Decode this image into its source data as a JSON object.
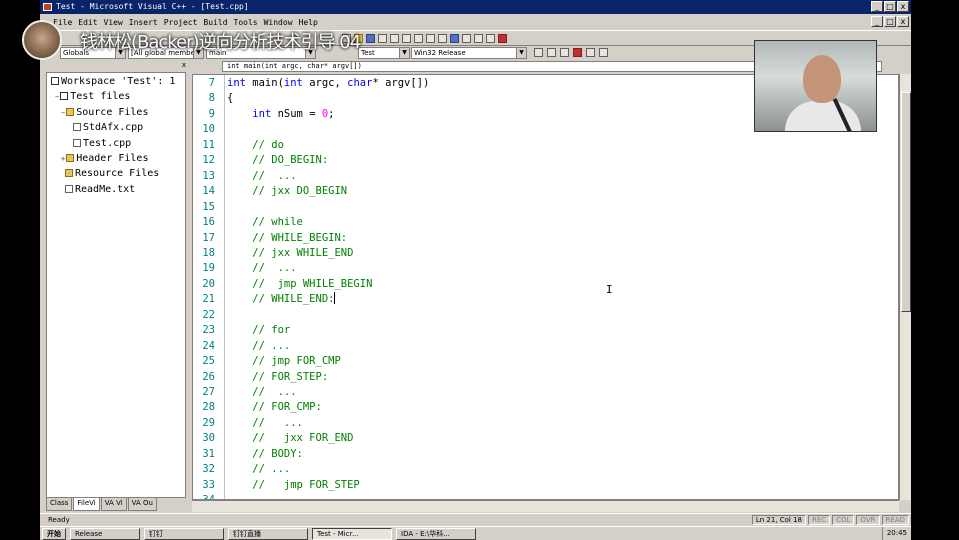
{
  "window": {
    "title": "Test - Microsoft Visual C++ - [Test.cpp]",
    "min_label": "_",
    "restore_label": "□",
    "close_label": "x"
  },
  "menu": [
    "File",
    "Edit",
    "View",
    "Insert",
    "Project",
    "Build",
    "Tools",
    "Window",
    "Help"
  ],
  "toolbar": {
    "scope_combo": "Globals",
    "members_combo": "[All global members",
    "function_combo": "main",
    "project_combo": "Test",
    "config_combo": "Win32 Release"
  },
  "workspace": {
    "close_label": "x",
    "tree": [
      {
        "label": "Workspace 'Test': 1",
        "icon": "workspace-icon",
        "kind": "ws",
        "expander": ""
      },
      {
        "label": "Test files",
        "icon": "project-icon",
        "kind": "ws",
        "expander": "−"
      },
      {
        "label": "Source Files",
        "icon": "folder-icon",
        "kind": "folder",
        "expander": "−"
      },
      {
        "label": "StdAfx.cpp",
        "icon": "file-icon",
        "kind": "file",
        "expander": ""
      },
      {
        "label": "Test.cpp",
        "icon": "file-icon",
        "kind": "file",
        "expander": ""
      },
      {
        "label": "Header Files",
        "icon": "folder-icon",
        "kind": "folder",
        "expander": "+"
      },
      {
        "label": "Resource Files",
        "icon": "folder-icon",
        "kind": "folder",
        "expander": ""
      },
      {
        "label": "ReadMe.txt",
        "icon": "file-icon",
        "kind": "file",
        "expander": ""
      }
    ],
    "tabs": [
      "Class",
      "FileVi",
      "VA Vi",
      "VA Ou"
    ]
  },
  "editor": {
    "function_bar": "int main(int argc, char* argv[])",
    "lines": [
      {
        "n": "7",
        "parts": [
          {
            "t": "int",
            "c": "kw"
          },
          {
            "t": " main(",
            "c": ""
          },
          {
            "t": "int",
            "c": "kw"
          },
          {
            "t": " argc, ",
            "c": ""
          },
          {
            "t": "char",
            "c": "kw"
          },
          {
            "t": "* argv[])",
            "c": ""
          }
        ]
      },
      {
        "n": "8",
        "parts": [
          {
            "t": "{",
            "c": ""
          }
        ]
      },
      {
        "n": "9",
        "parts": [
          {
            "t": "    ",
            "c": ""
          },
          {
            "t": "int",
            "c": "kw"
          },
          {
            "t": " nSum = ",
            "c": ""
          },
          {
            "t": "0",
            "c": "num"
          },
          {
            "t": ";",
            "c": ""
          }
        ]
      },
      {
        "n": "10",
        "parts": []
      },
      {
        "n": "11",
        "parts": [
          {
            "t": "    // do",
            "c": "cm"
          }
        ]
      },
      {
        "n": "12",
        "parts": [
          {
            "t": "    // DO_BEGIN:",
            "c": "cm"
          }
        ]
      },
      {
        "n": "13",
        "parts": [
          {
            "t": "    //  ...",
            "c": "cm"
          }
        ]
      },
      {
        "n": "14",
        "parts": [
          {
            "t": "    // jxx DO_BEGIN",
            "c": "cm"
          }
        ]
      },
      {
        "n": "15",
        "parts": []
      },
      {
        "n": "16",
        "parts": [
          {
            "t": "    // while",
            "c": "cm"
          }
        ]
      },
      {
        "n": "17",
        "parts": [
          {
            "t": "    // WHILE_BEGIN:",
            "c": "cm"
          }
        ]
      },
      {
        "n": "18",
        "parts": [
          {
            "t": "    // jxx WHILE_END",
            "c": "cm"
          }
        ]
      },
      {
        "n": "19",
        "parts": [
          {
            "t": "    //  ...",
            "c": "cm"
          }
        ]
      },
      {
        "n": "20",
        "parts": [
          {
            "t": "    //  jmp WHILE_BEGIN",
            "c": "cm"
          }
        ]
      },
      {
        "n": "21",
        "parts": [
          {
            "t": "    // WHILE_END:",
            "c": "cm"
          }
        ],
        "caret": true
      },
      {
        "n": "22",
        "parts": []
      },
      {
        "n": "23",
        "parts": [
          {
            "t": "    // for",
            "c": "cm"
          }
        ]
      },
      {
        "n": "24",
        "parts": [
          {
            "t": "    // ...",
            "c": "cm"
          }
        ]
      },
      {
        "n": "25",
        "parts": [
          {
            "t": "    // jmp FOR_CMP",
            "c": "cm"
          }
        ]
      },
      {
        "n": "26",
        "parts": [
          {
            "t": "    // FOR_STEP:",
            "c": "cm"
          }
        ]
      },
      {
        "n": "27",
        "parts": [
          {
            "t": "    //  ...",
            "c": "cm"
          }
        ]
      },
      {
        "n": "28",
        "parts": [
          {
            "t": "    // FOR_CMP:",
            "c": "cm"
          }
        ]
      },
      {
        "n": "29",
        "parts": [
          {
            "t": "    //   ...",
            "c": "cm"
          }
        ]
      },
      {
        "n": "30",
        "parts": [
          {
            "t": "    //   jxx FOR_END",
            "c": "cm"
          }
        ]
      },
      {
        "n": "31",
        "parts": [
          {
            "t": "    // BODY:",
            "c": "cm"
          }
        ]
      },
      {
        "n": "32",
        "parts": [
          {
            "t": "    // ...",
            "c": "cm"
          }
        ]
      },
      {
        "n": "33",
        "parts": [
          {
            "t": "    //   jmp FOR_STEP",
            "c": "cm"
          }
        ]
      },
      {
        "n": "34",
        "parts": []
      }
    ]
  },
  "status": {
    "text": "Ready",
    "position": "Ln 21, Col 18",
    "panels": [
      {
        "label": "REC",
        "on": false
      },
      {
        "label": "COL",
        "on": false
      },
      {
        "label": "OVR",
        "on": false
      },
      {
        "label": "READ",
        "on": false
      }
    ]
  },
  "taskbar": {
    "start": "开始",
    "tasks": [
      {
        "label": "Release",
        "active": false
      },
      {
        "label": "钉钉",
        "active": false
      },
      {
        "label": "钉钉直播",
        "active": false
      },
      {
        "label": "Test - Micr...",
        "active": true
      },
      {
        "label": "IDA - E:\\华科...",
        "active": false
      }
    ],
    "clock": "20:45"
  },
  "overlay": {
    "watermark": "钱林松(Backer)逆向分析技术引导 04"
  },
  "colors": {
    "keyword": "#0000ff",
    "comment": "#008000",
    "number": "#ff00ff",
    "line_number": "#008080",
    "titlebar": "#0a246a"
  }
}
